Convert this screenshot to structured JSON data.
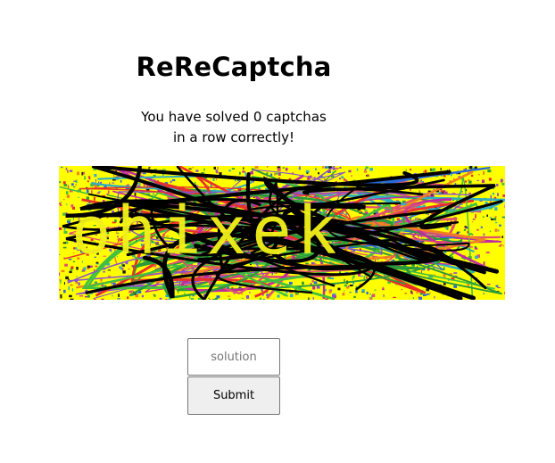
{
  "page": {
    "title": "ReReCaptcha",
    "status_line1": "You have solved 0 captchas",
    "status_line2": "in a row correctly!"
  },
  "captcha": {
    "text": "ohixek",
    "background_color": "#ffff00",
    "text_color": "#f2f21a",
    "scribble_color": "#000000"
  },
  "form": {
    "solution_placeholder": "solution",
    "solution_value": "",
    "submit_label": "Submit"
  }
}
